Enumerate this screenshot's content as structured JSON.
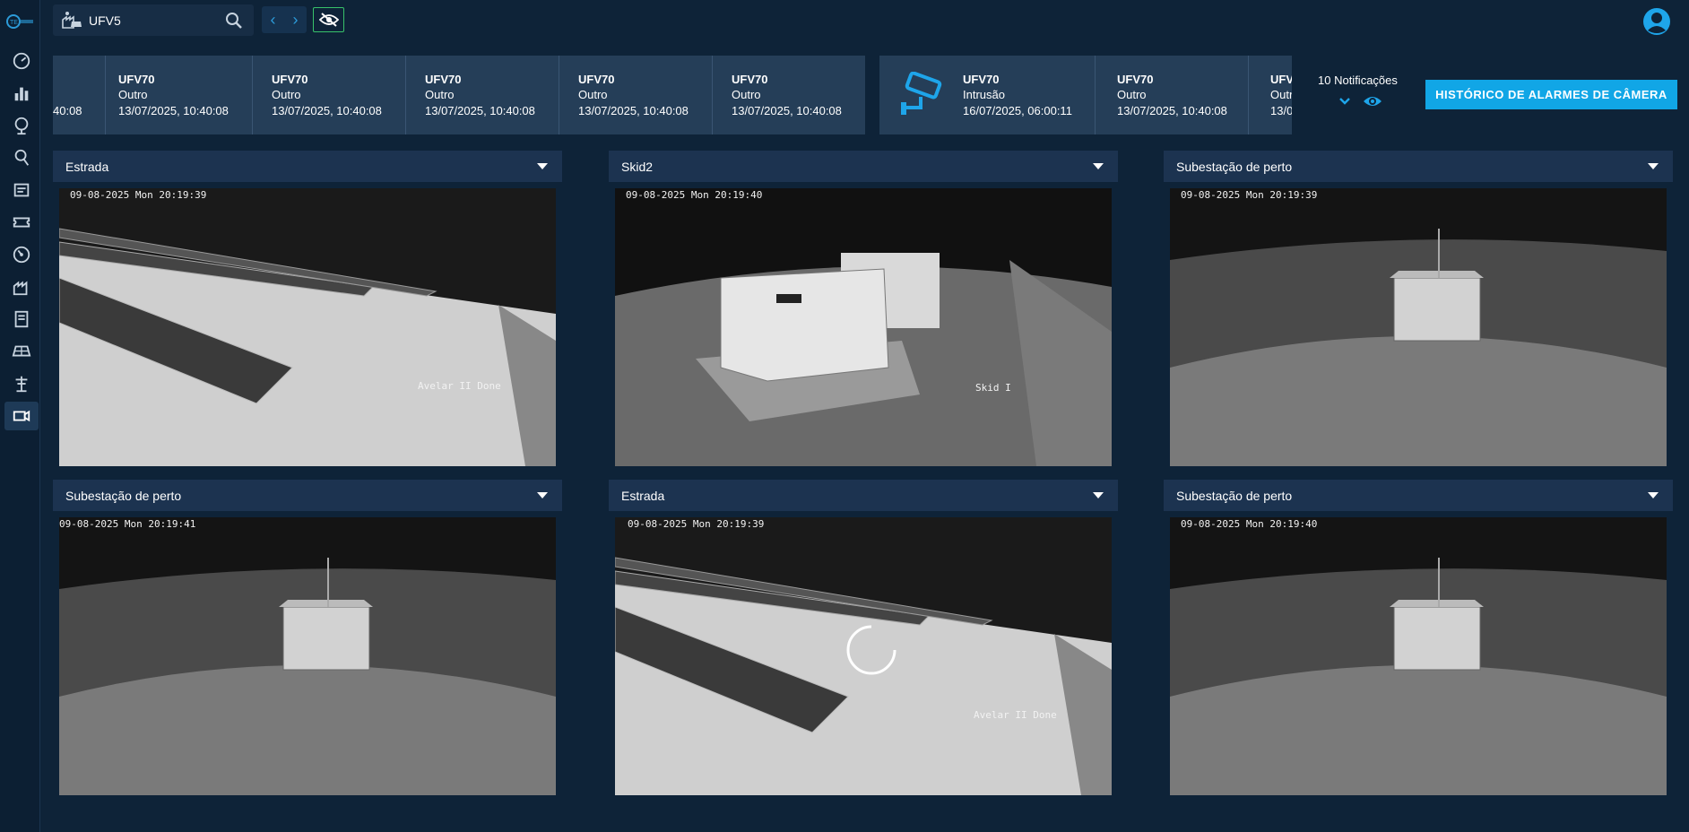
{
  "topbar": {
    "site_name": "UFV5",
    "prev_label": "‹",
    "next_label": "›"
  },
  "alarms_strip_a": [
    {
      "line1": "",
      "line2": "",
      "line3": "40:08"
    },
    {
      "line1": "UFV70",
      "line2": "Outro",
      "line3": "13/07/2025, 10:40:08"
    },
    {
      "line1": "UFV70",
      "line2": "Outro",
      "line3": "13/07/2025, 10:40:08"
    },
    {
      "line1": "UFV70",
      "line2": "Outro",
      "line3": "13/07/2025, 10:40:08"
    },
    {
      "line1": "UFV70",
      "line2": "Outro",
      "line3": "13/07/2025, 10:40:08"
    },
    {
      "line1": "UFV70",
      "line2": "Outro",
      "line3": "13/07/2025, 10:40:08"
    }
  ],
  "alarms_strip_b": [
    {
      "line1": "UFV70",
      "line2": "Intrusão",
      "line3": "16/07/2025, 06:00:11"
    },
    {
      "line1": "UFV70",
      "line2": "Outro",
      "line3": "13/07/2025, 10:40:08"
    },
    {
      "line1": "UFV",
      "line2": "Outr",
      "line3": "13/0"
    }
  ],
  "notifications": {
    "label": "10 Notificações"
  },
  "history_button_label": "HISTÓRICO DE ALARMES DE CÂMERA",
  "cameras": [
    {
      "name": "Estrada",
      "timestamp": "09-08-2025 Mon 20:19:39",
      "overlay": "Avelar II Done"
    },
    {
      "name": "Skid2",
      "timestamp": "09-08-2025 Mon 20:19:40",
      "overlay": "Skid I"
    },
    {
      "name": "Subestação de perto",
      "timestamp": "09-08-2025 Mon 20:19:39",
      "overlay": ""
    },
    {
      "name": "Subestação de perto",
      "timestamp": "09-08-2025 Mon 20:19:41",
      "overlay": ""
    },
    {
      "name": "Estrada",
      "timestamp": "09-08-2025 Mon 20:19:39",
      "overlay": "Avelar II Done"
    },
    {
      "name": "Subestação de perto",
      "timestamp": "09-08-2025 Mon 20:19:40",
      "overlay": ""
    }
  ],
  "colors": {
    "background": "#0e2338",
    "accent": "#11a6e6",
    "icon_blue": "#2c9bd9",
    "toggle_green": "#38c26a"
  },
  "icons": {
    "sidebar": [
      "dashboard-gauge-icon",
      "bar-chart-icon",
      "globe-icon",
      "search-person-icon",
      "document-icon",
      "ticket-icon",
      "speedometer-icon",
      "plant-icon",
      "report-icon",
      "solar-panel-icon",
      "tower-icon",
      "video-camera-icon"
    ]
  }
}
